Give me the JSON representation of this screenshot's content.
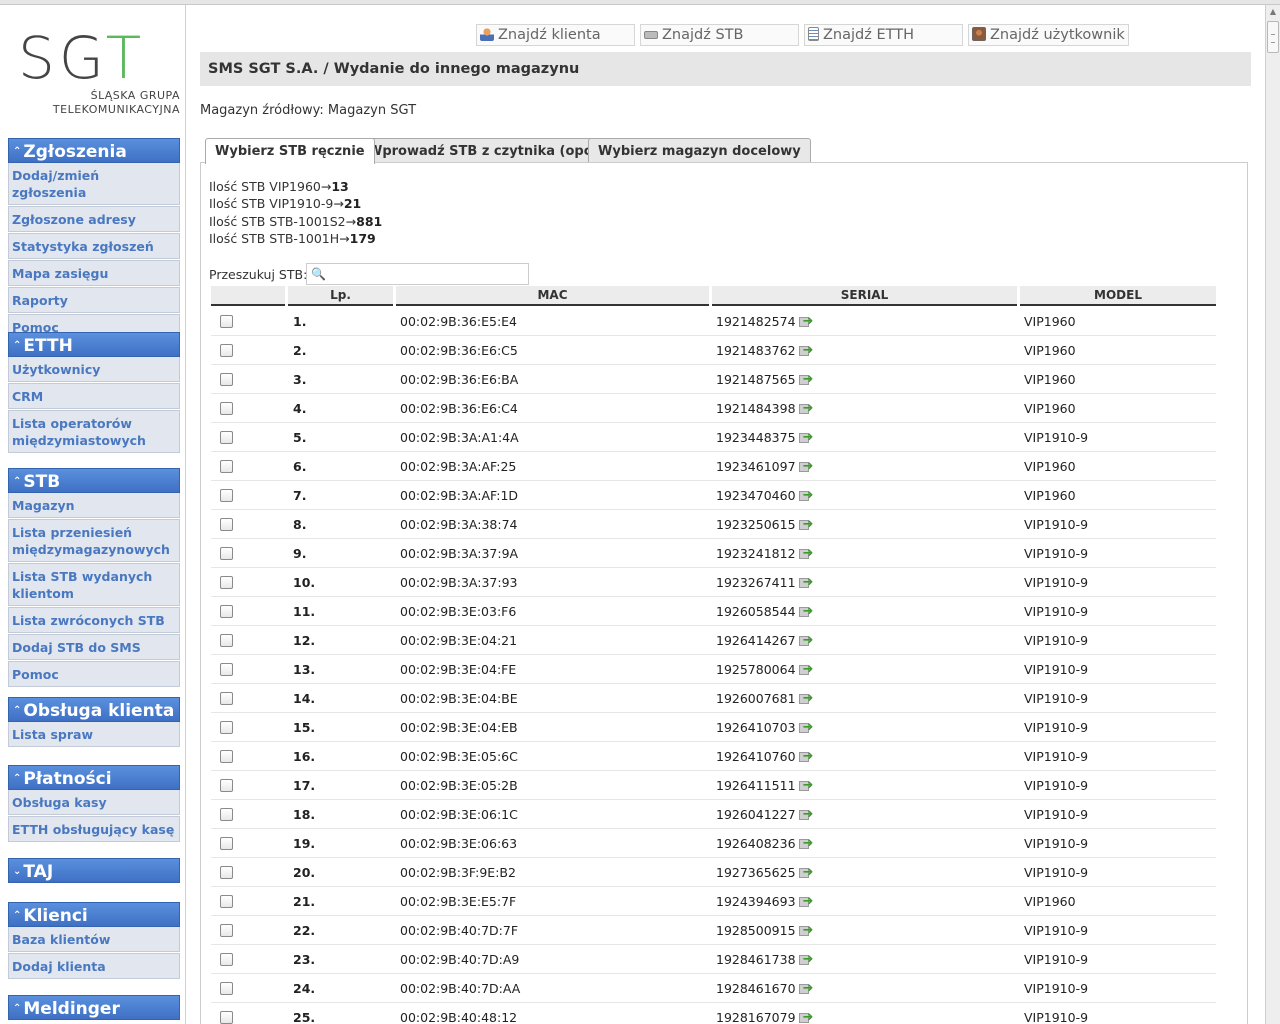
{
  "logo": {
    "text_sg": "SG",
    "text_t": "T",
    "line1": "ŚLĄSKA GRUPA",
    "line2": "TELEKOMUNIKACYJNA"
  },
  "sidebar": {
    "sections": [
      {
        "title": "Zgłoszenia",
        "items": [
          "Dodaj/zmień zgłoszenia",
          "Zgłoszone adresy",
          "Statystyka zgłoszeń",
          "Mapa zasięgu",
          "Raporty",
          "Pomoc"
        ]
      },
      {
        "title": "ETTH",
        "items": [
          "Użytkownicy",
          "CRM",
          "Lista operatorów międzymiastowych"
        ]
      },
      {
        "title": "STB",
        "items": [
          "Magazyn",
          "Lista przeniesień międzymagazynowych",
          "Lista STB wydanych klientom",
          "Lista zwróconych STB",
          "Dodaj STB do SMS",
          "Pomoc"
        ]
      },
      {
        "title": "Obsługa klienta",
        "items": [
          "Lista spraw"
        ]
      },
      {
        "title": "Płatności",
        "items": [
          "Obsługa kasy",
          "ETTH obsługujący kasę"
        ]
      },
      {
        "title": "TAJ",
        "items": []
      },
      {
        "title": "Klienci",
        "items": [
          "Baza klientów",
          "Dodaj klienta"
        ]
      },
      {
        "title": "Meldinger",
        "items": []
      }
    ]
  },
  "quick_links": [
    "Znajdź klienta",
    "Znajdź STB",
    "Znajdź ETTH",
    "Znajdź użytkownik"
  ],
  "page_title": "SMS SGT S.A. / Wydanie do innego magazynu",
  "source_warehouse": "Magazyn źródłowy: Magazyn SGT",
  "tabs": [
    "Wybierz STB ręcznie",
    "Wprowadź STB z czytnika (opcja)",
    "Wybierz magazyn docelowy"
  ],
  "counts": [
    {
      "label": "Ilość STB VIP1960→",
      "value": "13"
    },
    {
      "label": "Ilość STB VIP1910-9→",
      "value": "21"
    },
    {
      "label": "Ilość STB STB-1001S2→",
      "value": "881"
    },
    {
      "label": "Ilość STB STB-1001H→",
      "value": "179"
    }
  ],
  "search": {
    "label": "Przeszukuj STB:",
    "value": ""
  },
  "table": {
    "headers": [
      "",
      "Lp.",
      "MAC",
      "SERIAL",
      "MODEL"
    ],
    "rows": [
      [
        "1.",
        "00:02:9B:36:E5:E4",
        "1921482574",
        "VIP1960"
      ],
      [
        "2.",
        "00:02:9B:36:E6:C5",
        "1921483762",
        "VIP1960"
      ],
      [
        "3.",
        "00:02:9B:36:E6:BA",
        "1921487565",
        "VIP1960"
      ],
      [
        "4.",
        "00:02:9B:36:E6:C4",
        "1921484398",
        "VIP1960"
      ],
      [
        "5.",
        "00:02:9B:3A:A1:4A",
        "1923448375",
        "VIP1910-9"
      ],
      [
        "6.",
        "00:02:9B:3A:AF:25",
        "1923461097",
        "VIP1960"
      ],
      [
        "7.",
        "00:02:9B:3A:AF:1D",
        "1923470460",
        "VIP1960"
      ],
      [
        "8.",
        "00:02:9B:3A:38:74",
        "1923250615",
        "VIP1910-9"
      ],
      [
        "9.",
        "00:02:9B:3A:37:9A",
        "1923241812",
        "VIP1910-9"
      ],
      [
        "10.",
        "00:02:9B:3A:37:93",
        "1923267411",
        "VIP1910-9"
      ],
      [
        "11.",
        "00:02:9B:3E:03:F6",
        "1926058544",
        "VIP1910-9"
      ],
      [
        "12.",
        "00:02:9B:3E:04:21",
        "1926414267",
        "VIP1910-9"
      ],
      [
        "13.",
        "00:02:9B:3E:04:FE",
        "1925780064",
        "VIP1910-9"
      ],
      [
        "14.",
        "00:02:9B:3E:04:BE",
        "1926007681",
        "VIP1910-9"
      ],
      [
        "15.",
        "00:02:9B:3E:04:EB",
        "1926410703",
        "VIP1910-9"
      ],
      [
        "16.",
        "00:02:9B:3E:05:6C",
        "1926410760",
        "VIP1910-9"
      ],
      [
        "17.",
        "00:02:9B:3E:05:2B",
        "1926411511",
        "VIP1910-9"
      ],
      [
        "18.",
        "00:02:9B:3E:06:1C",
        "1926041227",
        "VIP1910-9"
      ],
      [
        "19.",
        "00:02:9B:3E:06:63",
        "1926408236",
        "VIP1910-9"
      ],
      [
        "20.",
        "00:02:9B:3F:9E:B2",
        "1927365625",
        "VIP1910-9"
      ],
      [
        "21.",
        "00:02:9B:3E:E5:7F",
        "1924394693",
        "VIP1960"
      ],
      [
        "22.",
        "00:02:9B:40:7D:7F",
        "1928500915",
        "VIP1910-9"
      ],
      [
        "23.",
        "00:02:9B:40:7D:A9",
        "1928461738",
        "VIP1910-9"
      ],
      [
        "24.",
        "00:02:9B:40:7D:AA",
        "1928461670",
        "VIP1910-9"
      ],
      [
        "25.",
        "00:02:9B:40:48:12",
        "1928167079",
        "VIP1910-9"
      ]
    ]
  },
  "colors": {
    "menu_header": "#4a7fd0",
    "menu_item_bg": "#e1e6ef",
    "menu_item_text": "#4a78c0",
    "logo_accent": "#5cb85c",
    "action_arrow": "#3e9a2c"
  },
  "icons": {
    "menu_toggle": "chevron-double-up-icon",
    "taj_toggle": "chevron-double-down-icon",
    "row_action": "transfer-arrow-icon",
    "search": "magnifier-icon"
  }
}
